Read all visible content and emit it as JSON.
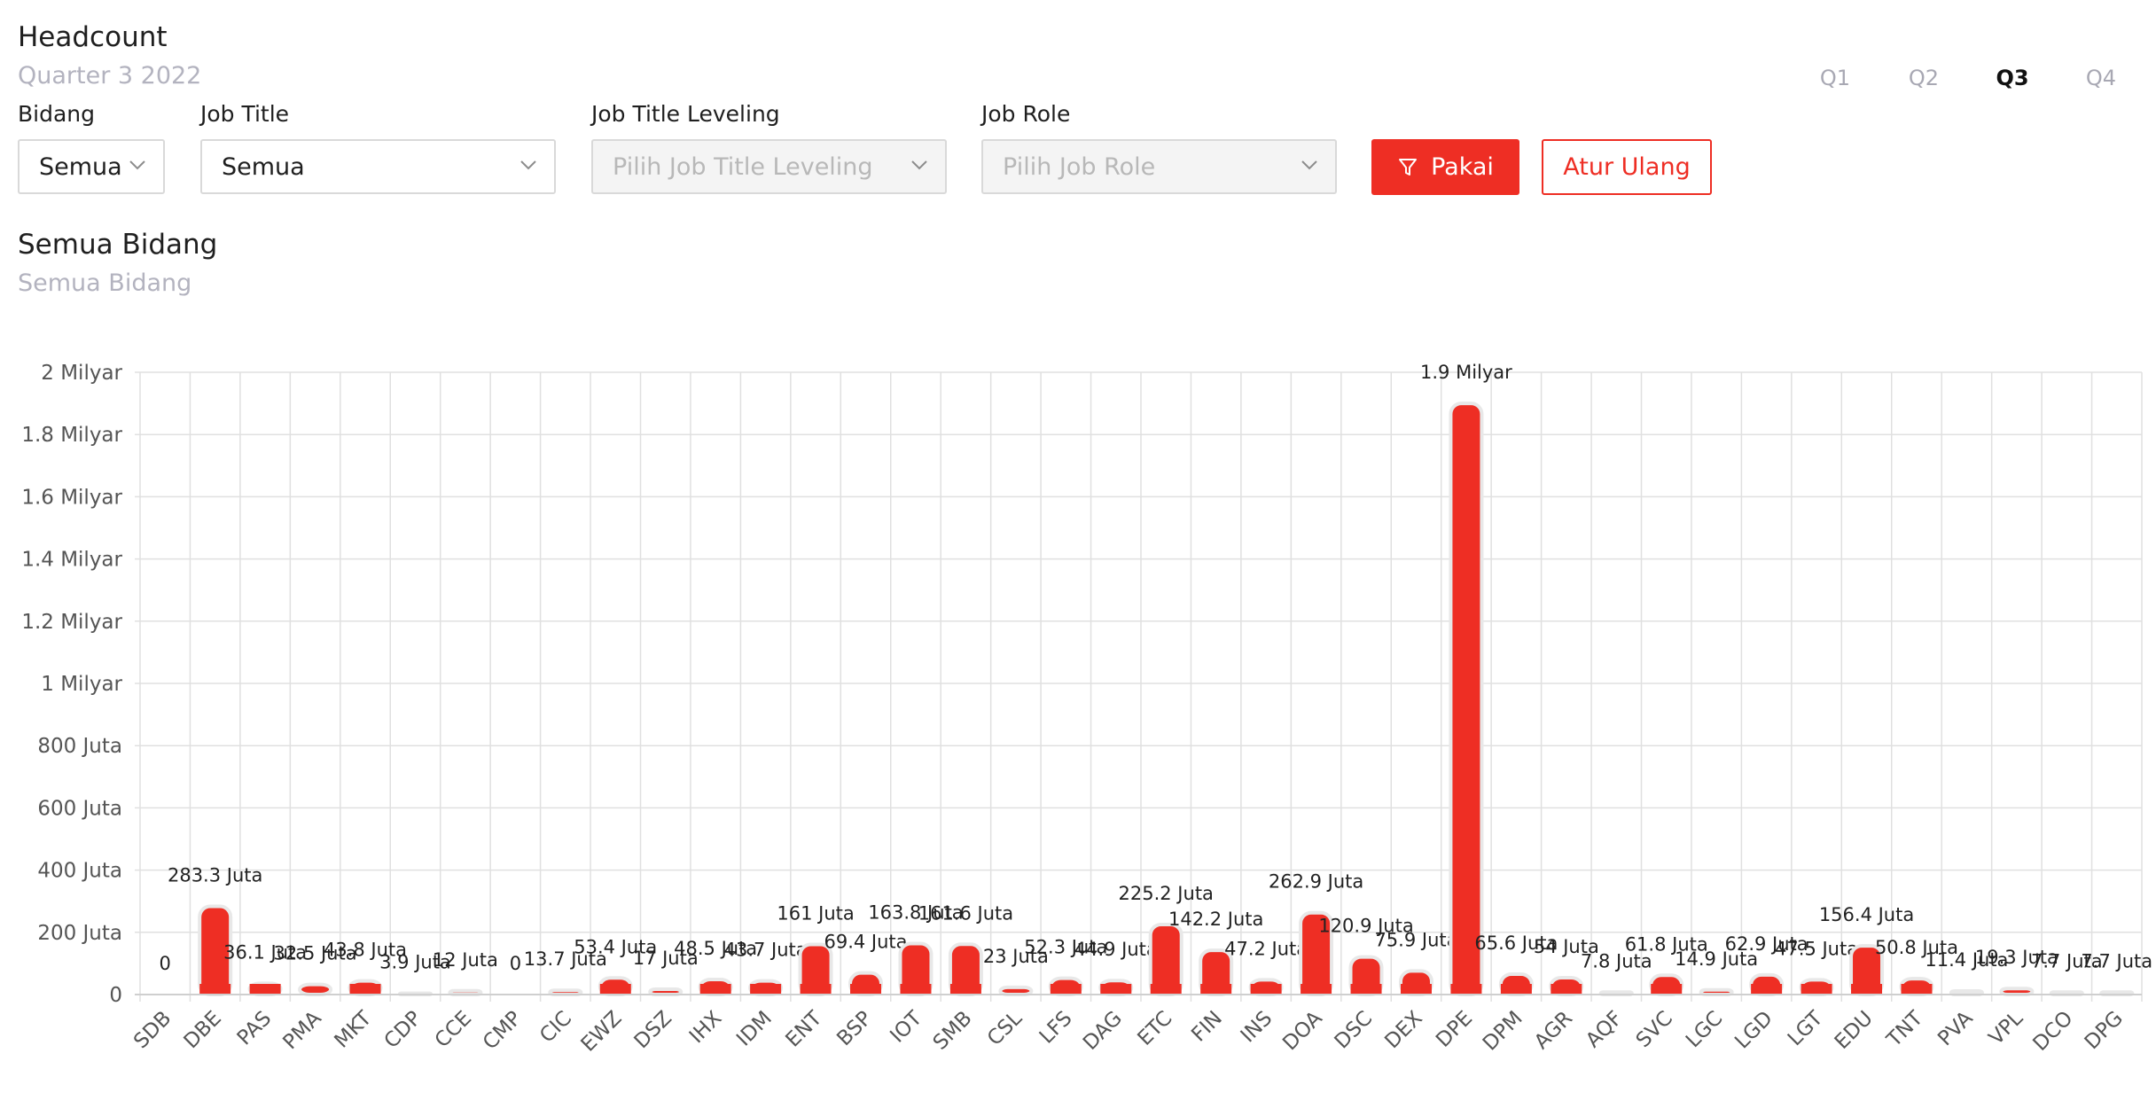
{
  "header": {
    "title": "Headcount",
    "subtitle": "Quarter 3 2022"
  },
  "quarters": [
    {
      "label": "Q1",
      "active": false
    },
    {
      "label": "Q2",
      "active": false
    },
    {
      "label": "Q3",
      "active": true
    },
    {
      "label": "Q4",
      "active": false
    }
  ],
  "filters": {
    "bidang": {
      "label": "Bidang",
      "value": "Semua"
    },
    "job_title": {
      "label": "Job Title",
      "value": "Semua"
    },
    "job_title_leveling": {
      "label": "Job Title Leveling",
      "placeholder": "Pilih Job Title Leveling"
    },
    "job_role": {
      "label": "Job Role",
      "placeholder": "Pilih Job Role"
    },
    "apply_label": "Pakai",
    "reset_label": "Atur Ulang"
  },
  "section": {
    "title": "Semua Bidang",
    "subtitle": "Semua Bidang"
  },
  "colors": {
    "accent": "#ee2e24",
    "grid": "#e0e0e0",
    "muted": "#b3b3bf"
  },
  "chart_data": {
    "type": "bar",
    "categories": [
      "SDB",
      "DBE",
      "PAS",
      "PMA",
      "MKT",
      "CDP",
      "CCE",
      "CMP",
      "CIC",
      "EWZ",
      "DSZ",
      "IHX",
      "IDM",
      "ENT",
      "BSP",
      "IOT",
      "SMB",
      "CSL",
      "LFS",
      "DAG",
      "ETC",
      "FIN",
      "INS",
      "DOA",
      "DSC",
      "DEX",
      "DPE",
      "DPM",
      "AGR",
      "AQF",
      "SVC",
      "LGC",
      "LGD",
      "LGT",
      "EDU",
      "TNT",
      "PVA",
      "VPL",
      "DCO",
      "DPG"
    ],
    "values": [
      0,
      283300000,
      36100000,
      32500000,
      43800000,
      3900000,
      12000000,
      0,
      13700000,
      53400000,
      17000000,
      48500000,
      43700000,
      161000000,
      69400000,
      163800000,
      161600000,
      23000000,
      52300000,
      44900000,
      225200000,
      142200000,
      47200000,
      262900000,
      120900000,
      75900000,
      1900000000,
      65600000,
      54000000,
      7800000,
      61800000,
      14900000,
      62900000,
      47500000,
      156400000,
      50800000,
      11400000,
      19300000,
      7700000,
      7700000
    ],
    "value_labels": [
      "0",
      "283.3 Juta",
      "36.1 Juta",
      "32.5 Juta",
      "43.8 Juta",
      "3.9 Juta",
      "12 Juta",
      "0",
      "13.7 Juta",
      "53.4 Juta",
      "17 Juta",
      "48.5 Juta",
      "43.7 Juta",
      "161 Juta",
      "69.4 Juta",
      "163.8 Juta",
      "161.6 Juta",
      "23 Juta",
      "52.3 Juta",
      "44.9 Juta",
      "225.2 Juta",
      "142.2 Juta",
      "47.2 Juta",
      "262.9 Juta",
      "120.9 Juta",
      "75.9 Juta",
      "1.9 Milyar",
      "65.6 Juta",
      "54 Juta",
      "7.8 Juta",
      "61.8 Juta",
      "14.9 Juta",
      "62.9 Juta",
      "47.5 Juta",
      "156.4 Juta",
      "50.8 Juta",
      "11.4 Juta",
      "19.3 Juta",
      "7.7 Juta",
      "7.7 Juta"
    ],
    "y_ticks": [
      "0",
      "200 Juta",
      "400 Juta",
      "600 Juta",
      "800 Juta",
      "1 Milyar",
      "1.2 Milyar",
      "1.4 Milyar",
      "1.6 Milyar",
      "1.8 Milyar",
      "2 Milyar"
    ],
    "ylim": [
      0,
      2000000000
    ],
    "grid": true,
    "color": "#ee2e24"
  }
}
